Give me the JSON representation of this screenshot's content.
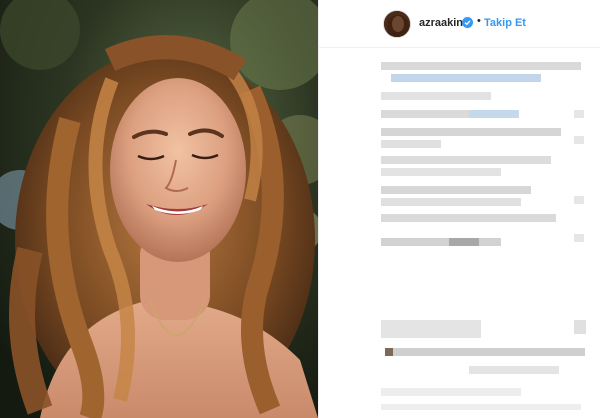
{
  "post": {
    "username": "azraakin",
    "separator": "•",
    "follow_label": "Takip Et"
  },
  "icons": {
    "verified": "verified-badge-icon",
    "avatar": "profile-avatar"
  },
  "colors": {
    "link_blue": "#3897f0",
    "text_dark": "#262626",
    "border": "#efefef"
  }
}
